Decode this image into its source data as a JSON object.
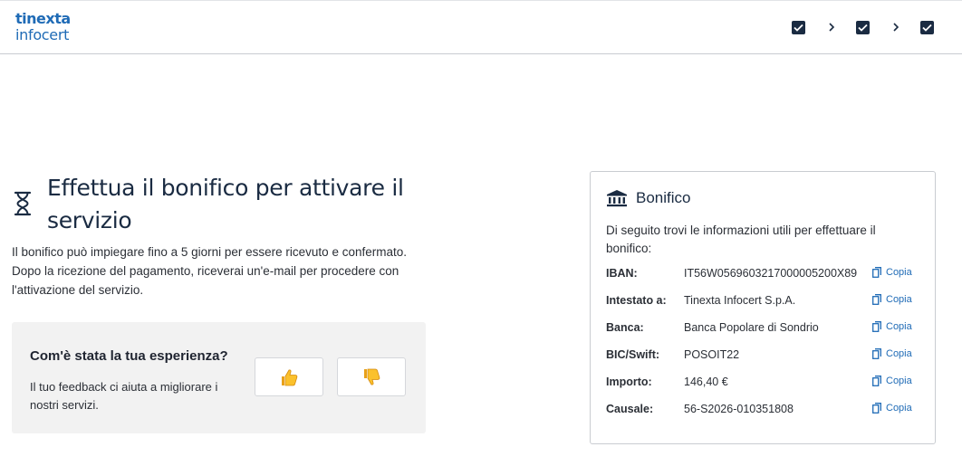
{
  "header": {
    "logo_line1": "tinexta",
    "logo_line2": "infocert",
    "steps": [
      {
        "icon": "check-icon",
        "completed": true
      },
      {
        "icon": "check-icon",
        "completed": true
      },
      {
        "icon": "check-icon",
        "completed": true
      }
    ]
  },
  "main": {
    "title": "Effettua il bonifico per attivare il servizio",
    "description_1": "Il bonifico può impiegare fino a 5 giorni per essere ricevuto e confermato.",
    "description_2": "Dopo la ricezione del pagamento, riceverai un'e-mail per procedere con l'attivazione del servizio."
  },
  "feedback": {
    "title": "Com'è stata la tua esperienza?",
    "subtitle": "Il tuo feedback ci aiuta a migliorare i nostri servizi.",
    "thumbs_up_icon": "thumbs-up-icon",
    "thumbs_down_icon": "thumbs-down-icon"
  },
  "bonifico": {
    "title": "Bonifico",
    "intro": "Di seguito trovi le informazioni utili per effettuare il bonifico:",
    "copy_label": "Copia",
    "rows": [
      {
        "label": "IBAN:",
        "value": "IT56W0569603217000005200X89"
      },
      {
        "label": "Intestato a:",
        "value": "Tinexta Infocert S.p.A."
      },
      {
        "label": "Banca:",
        "value": "Banca Popolare di Sondrio"
      },
      {
        "label": "BIC/Swift:",
        "value": "POSOIT22"
      },
      {
        "label": "Importo:",
        "value": "146,40 €"
      },
      {
        "label": "Causale:",
        "value": "56-S2026-010351808"
      }
    ]
  },
  "colors": {
    "brand_blue": "#1f6bb6",
    "dark_navy": "#1a2b42",
    "panel_gray": "#f2f2f2"
  }
}
